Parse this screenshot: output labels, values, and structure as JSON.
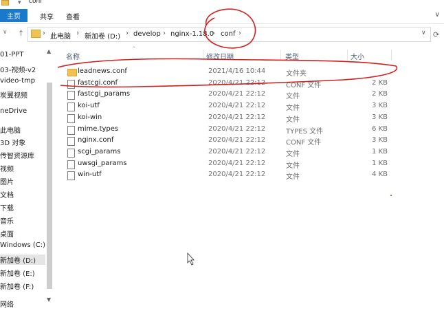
{
  "window": {
    "title": "conf"
  },
  "ribbon": {
    "tabs": [
      "主页",
      "共享",
      "查看"
    ],
    "active_tab": "主页"
  },
  "address": {
    "crumbs": [
      "此电脑",
      "新加卷 (D:)",
      "develop",
      "nginx-1.18.0",
      "conf"
    ],
    "back_label": "←",
    "forward_label": "→",
    "recent_label": "∨",
    "up_label": "↑"
  },
  "nav": {
    "items": [
      "01-PPT",
      "03-视频-v2",
      "video-tmp",
      "炭翼视频",
      "neDrive",
      "此电脑",
      "3D 对象",
      "传智资源库",
      "视频",
      "图片",
      "文档",
      "下载",
      "音乐",
      "桌面",
      "Windows (C:)",
      "新加卷 (D:)",
      "新加卷 (E:)",
      "新加卷 (F:)",
      "网络"
    ],
    "selected": "新加卷 (D:)"
  },
  "columns": {
    "name": "名称",
    "date": "修改日期",
    "type": "类型",
    "size": "大小"
  },
  "files": [
    {
      "name": "leadnews.conf",
      "date": "2021/4/16 10:44",
      "type": "文件夹",
      "size": "",
      "icon": "folder"
    },
    {
      "name": "fastcgi.conf",
      "date": "2020/4/21 22:12",
      "type": "CONF 文件",
      "size": "2 KB",
      "icon": "file"
    },
    {
      "name": "fastcgi_params",
      "date": "2020/4/21 22:12",
      "type": "文件",
      "size": "2 KB",
      "icon": "file"
    },
    {
      "name": "koi-utf",
      "date": "2020/4/21 22:12",
      "type": "文件",
      "size": "3 KB",
      "icon": "file"
    },
    {
      "name": "koi-win",
      "date": "2020/4/21 22:12",
      "type": "文件",
      "size": "3 KB",
      "icon": "file"
    },
    {
      "name": "mime.types",
      "date": "2020/4/21 22:12",
      "type": "TYPES 文件",
      "size": "6 KB",
      "icon": "file"
    },
    {
      "name": "nginx.conf",
      "date": "2020/4/21 22:12",
      "type": "CONF 文件",
      "size": "3 KB",
      "icon": "file"
    },
    {
      "name": "scgi_params",
      "date": "2020/4/21 22:12",
      "type": "文件",
      "size": "1 KB",
      "icon": "file"
    },
    {
      "name": "uwsgi_params",
      "date": "2020/4/21 22:12",
      "type": "文件",
      "size": "1 KB",
      "icon": "file"
    },
    {
      "name": "win-utf",
      "date": "2020/4/21 22:12",
      "type": "文件",
      "size": "4 KB",
      "icon": "file"
    }
  ],
  "colors": {
    "accent": "#1979ca",
    "annotation": "#d21f1f",
    "folder": "#f0c24f"
  }
}
